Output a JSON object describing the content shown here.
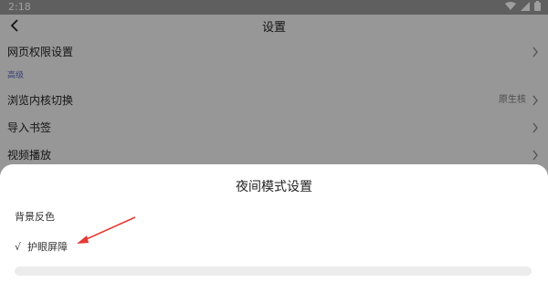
{
  "status_bar": {
    "time": "2:18",
    "icons": [
      "wifi-icon",
      "signal-icon",
      "battery-icon"
    ]
  },
  "app_bar": {
    "title": "设置",
    "back_icon": "back-arrow-icon"
  },
  "list": {
    "item_web_permissions": "网页权限设置",
    "section_advanced": "高级",
    "item_browser_kernel": "浏览内核切换",
    "item_browser_kernel_value": "原生核",
    "item_import_bookmarks": "导入书签",
    "item_video_playback": "视频播放"
  },
  "dialog": {
    "title": "夜间模式设置",
    "options": [
      {
        "label": "背景反色",
        "selected": false
      },
      {
        "label": "护眼屏障",
        "selected": true
      }
    ],
    "check_mark": "√"
  },
  "colors": {
    "accent_section": "#5c6bc0",
    "annotation_arrow": "#e53935",
    "scrim": "rgba(0,0,0,0.38)"
  }
}
